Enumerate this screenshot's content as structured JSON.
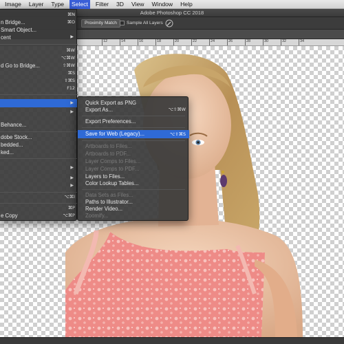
{
  "menubar": {
    "items": [
      "Image",
      "Layer",
      "Type",
      "Select",
      "Filter",
      "3D",
      "View",
      "Window",
      "Help"
    ],
    "active_index": 3
  },
  "app": {
    "title": "Adobe Photoshop CC 2018"
  },
  "options_bar": {
    "proximity_match": "Proximity Match",
    "sample_all_layers": "Sample All Layers",
    "sample_all_layers_checked": false,
    "brush_icon": "brush-settings-icon"
  },
  "ruler": {
    "ticks": [
      "12",
      "14",
      "16",
      "18",
      "20",
      "22",
      "24",
      "26",
      "28",
      "30",
      "32",
      "34"
    ]
  },
  "file_menu": {
    "items": [
      {
        "label": "",
        "shortcut": "⌘N"
      },
      {
        "label": "n Bridge...",
        "shortcut": "⌘O"
      },
      {
        "label": "Smart Object...",
        "shortcut": ""
      },
      {
        "label": "cent",
        "shortcut": ""
      },
      {
        "label": "",
        "shortcut": "⌘W"
      },
      {
        "label": "",
        "shortcut": "⌥⌘W"
      },
      {
        "label": "d Go to Bridge...",
        "shortcut": "⇧⌘W"
      },
      {
        "label": "",
        "shortcut": "⌘S"
      },
      {
        "label": "",
        "shortcut": "⇧⌘S"
      },
      {
        "label": "",
        "shortcut": "F12"
      },
      {
        "label": "",
        "shortcut": ""
      },
      {
        "label": "Behance...",
        "shortcut": ""
      },
      {
        "label": "dobe Stock...",
        "shortcut": ""
      },
      {
        "label": "bedded...",
        "shortcut": ""
      },
      {
        "label": "ked...",
        "shortcut": ""
      },
      {
        "label": "",
        "shortcut": ""
      },
      {
        "label": "",
        "shortcut": "⌥⌘I"
      },
      {
        "label": "",
        "shortcut": "⌘P"
      },
      {
        "label": "e Copy",
        "shortcut": "⌥⌘P"
      }
    ]
  },
  "export_menu": {
    "items": [
      {
        "label": "Quick Export as PNG",
        "shortcut": ""
      },
      {
        "label": "Export As...",
        "shortcut": "⌥⇧⌘W"
      },
      {
        "label": "Export Preferences...",
        "shortcut": ""
      },
      {
        "label": "Save for Web (Legacy)...",
        "shortcut": "⌥⇧⌘S"
      },
      {
        "label": "Artboards to Files...",
        "shortcut": ""
      },
      {
        "label": "Artboards to PDF...",
        "shortcut": ""
      },
      {
        "label": "Layer Comps to Files...",
        "shortcut": ""
      },
      {
        "label": "Layer Comps to PDF...",
        "shortcut": ""
      },
      {
        "label": "Layers to Files...",
        "shortcut": ""
      },
      {
        "label": "Color Lookup Tables...",
        "shortcut": ""
      },
      {
        "label": "Data Sets as Files...",
        "shortcut": ""
      },
      {
        "label": "Paths to Illustrator...",
        "shortcut": ""
      },
      {
        "label": "Render Video...",
        "shortcut": ""
      },
      {
        "label": "Zoomify...",
        "shortcut": ""
      }
    ]
  }
}
